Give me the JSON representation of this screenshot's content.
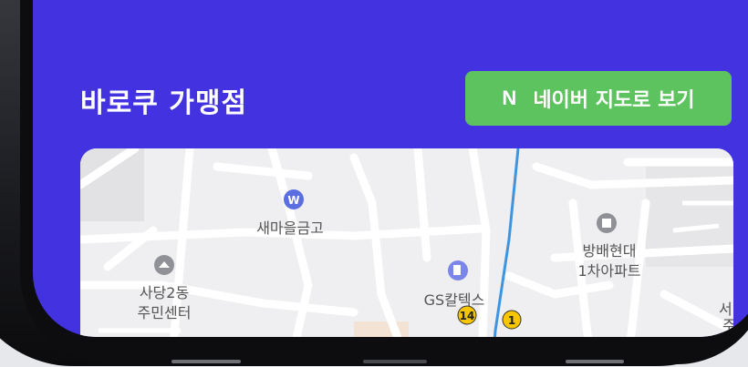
{
  "section": {
    "title": "바로쿠 가맹점"
  },
  "naver_button": {
    "logo": "N",
    "label": "네이버 지도로 보기"
  },
  "map": {
    "places": {
      "bank": "새마을금고",
      "community_center_line1": "사당2동",
      "community_center_line2": "주민센터",
      "gas_station": "GS칼텍스",
      "apartment_line1": "방배현대",
      "apartment_line2": "1차아파트",
      "edge_label_1": "서",
      "edge_label_2": "주"
    },
    "route_badges": [
      "14",
      "1"
    ],
    "colors": {
      "road": "#ffffff",
      "background": "#efeff1",
      "subway_line": "#3e95de",
      "poi_icon": "#8f9196",
      "bank_icon": "#5b6fe3",
      "badge": "#f7c600"
    }
  },
  "theme": {
    "accent": "#4332e0",
    "naver_green": "#5cc35f"
  }
}
